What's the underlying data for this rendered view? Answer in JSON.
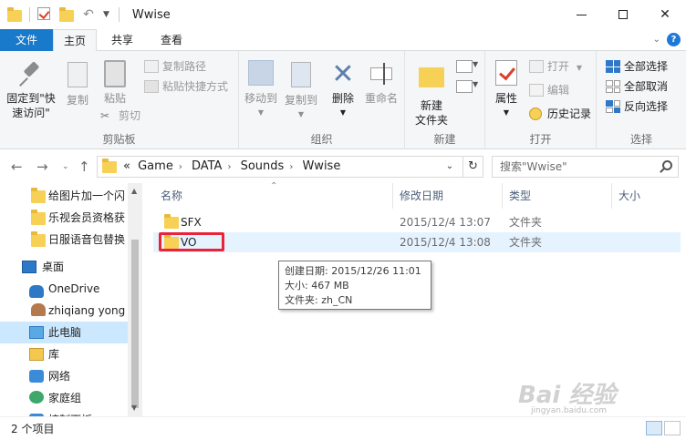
{
  "window": {
    "title": "Wwise"
  },
  "tabs": {
    "file": "文件",
    "home": "主页",
    "share": "共享",
    "view": "查看"
  },
  "ribbon": {
    "clipboard": {
      "label": "剪贴板",
      "pin": "固定到\"快速访问\"",
      "pin_line1": "固定到\"快",
      "pin_line2": "速访问\"",
      "copy": "复制",
      "paste": "粘贴",
      "copy_path": "复制路径",
      "paste_shortcut": "粘贴快捷方式",
      "cut": "剪切"
    },
    "organize": {
      "label": "组织",
      "move_to": "移动到",
      "copy_to": "复制到",
      "delete": "删除",
      "rename": "重命名"
    },
    "new": {
      "label": "新建",
      "new_folder_line1": "新建",
      "new_folder_line2": "文件夹"
    },
    "open": {
      "label": "打开",
      "properties": "属性",
      "open": "打开",
      "edit": "编辑",
      "history": "历史记录"
    },
    "select": {
      "label": "选择",
      "select_all": "全部选择",
      "select_none": "全部取消",
      "invert": "反向选择"
    }
  },
  "address": {
    "prefix": "«",
    "crumbs": [
      "Game",
      "DATA",
      "Sounds",
      "Wwise"
    ],
    "search_placeholder": "搜索\"Wwise\""
  },
  "nav": {
    "items": [
      {
        "label": "给图片加一个闪"
      },
      {
        "label": "乐视会员资格获"
      },
      {
        "label": "日服语音包替换"
      },
      {
        "label": "桌面"
      },
      {
        "label": "OneDrive"
      },
      {
        "label": "zhiqiang yong"
      },
      {
        "label": "此电脑"
      },
      {
        "label": "库"
      },
      {
        "label": "网络"
      },
      {
        "label": "家庭组"
      },
      {
        "label": "控制面板"
      }
    ]
  },
  "columns": {
    "name": "名称",
    "date": "修改日期",
    "type": "类型",
    "size": "大小"
  },
  "files": [
    {
      "name": "SFX",
      "date": "2015/12/4 13:07",
      "type": "文件夹"
    },
    {
      "name": "VO",
      "date": "2015/12/4 13:08",
      "type": "文件夹"
    }
  ],
  "tooltip": {
    "line1": "创建日期: 2015/12/26 11:01",
    "line2": "大小: 467 MB",
    "line3": "文件夹: zh_CN"
  },
  "status": {
    "count": "2 个项目"
  },
  "watermark": {
    "main": "Bai 经验",
    "sub": "jingyan.baidu.com"
  },
  "colors": {
    "accent": "#1979ca",
    "selection": "#cce8ff",
    "hover": "#e5f3ff",
    "highlight_box": "#e8233a",
    "folder": "#f7d056"
  }
}
